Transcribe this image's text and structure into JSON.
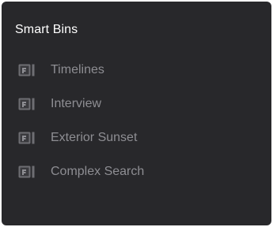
{
  "panel": {
    "title": "Smart Bins"
  },
  "bins": {
    "items": [
      {
        "label": "Timelines",
        "icon": "smart-bin-icon"
      },
      {
        "label": "Interview",
        "icon": "smart-bin-icon"
      },
      {
        "label": "Exterior Sunset",
        "icon": "smart-bin-icon"
      },
      {
        "label": "Complex Search",
        "icon": "smart-bin-icon"
      }
    ]
  },
  "colors": {
    "panel_background": "#28282b",
    "title_text": "#ffffff",
    "item_text": "#8e8e93",
    "icon": "#6e6e73"
  }
}
